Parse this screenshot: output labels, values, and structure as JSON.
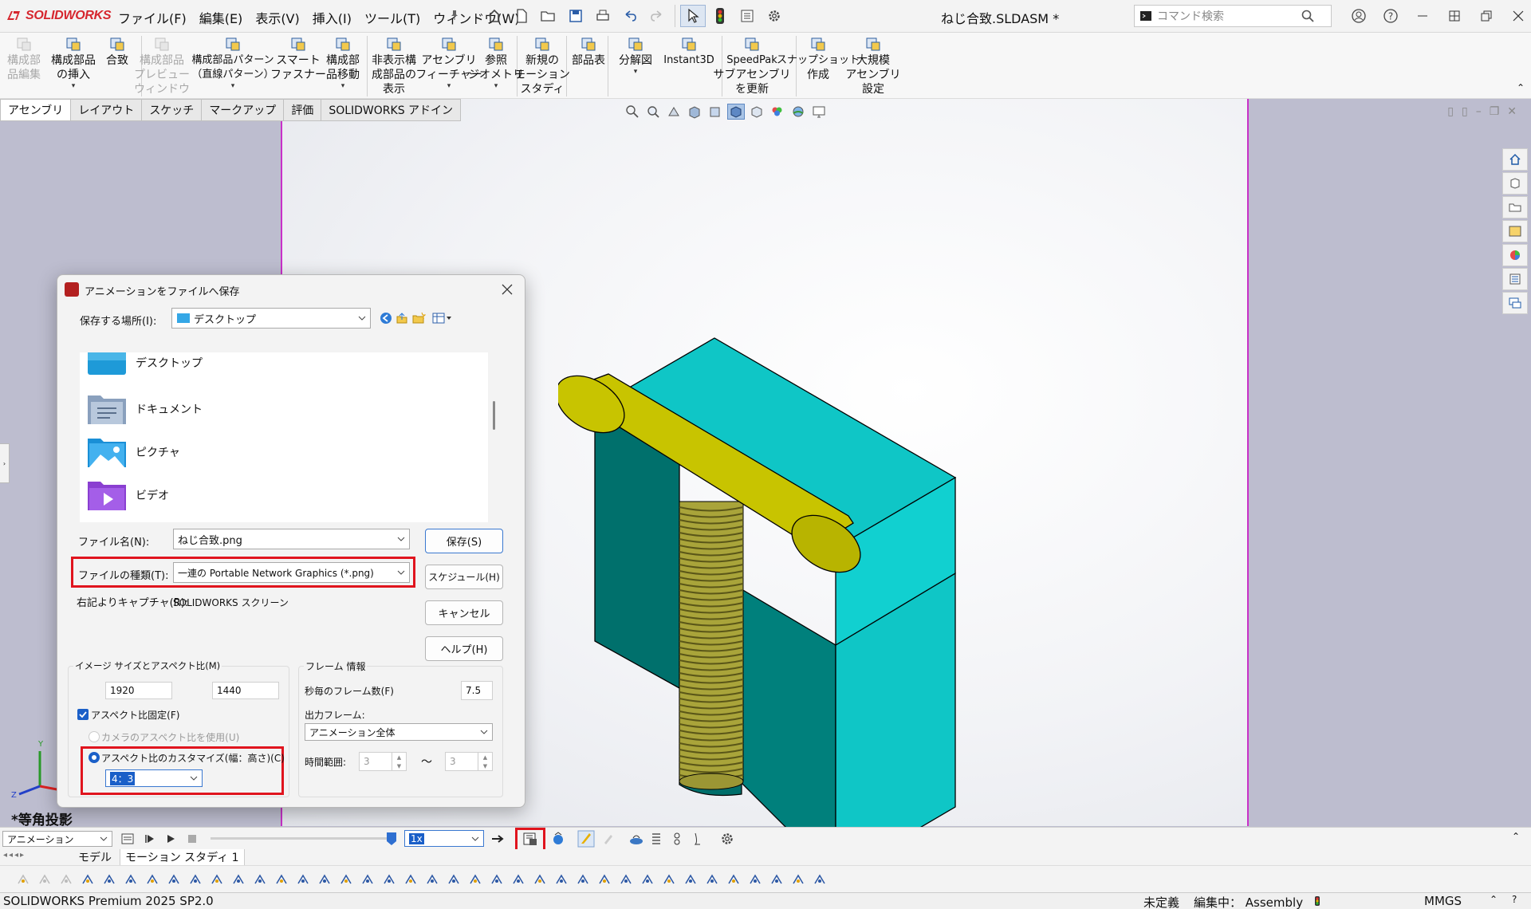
{
  "app": {
    "brand": "SOLIDWORKS",
    "doc_title": "ねじ合致.SLDASM *"
  },
  "menu": [
    "ファイル(F)",
    "編集(E)",
    "表示(V)",
    "挿入(I)",
    "ツール(T)",
    "ウィンドウ(W)"
  ],
  "search": {
    "placeholder": "コマンド検索"
  },
  "ribbon": [
    {
      "l1": "構成部",
      "l2": "品編集",
      "l3": "",
      "disabled": true,
      "icon": "edit-component-icon"
    },
    {
      "l1": "構成部品",
      "l2": "の挿入",
      "l3": "",
      "disabled": false,
      "icon": "insert-components-icon",
      "dropdown": true
    },
    {
      "l1": "合致",
      "l2": "",
      "l3": "",
      "disabled": false,
      "icon": "mate-icon"
    },
    {
      "l1": "構成部品",
      "l2": "プレビュー",
      "l3": "ウィンドウ",
      "disabled": true,
      "icon": "component-preview-icon"
    },
    {
      "l1": "構成部品パターン",
      "l2": "（直線パターン）",
      "l3": "",
      "disabled": false,
      "icon": "linear-pattern-icon",
      "dropdown": true
    },
    {
      "l1": "スマート",
      "l2": "ファスナー",
      "l3": "",
      "disabled": false,
      "icon": "smart-fasteners-icon"
    },
    {
      "l1": "構成部",
      "l2": "品移動",
      "l3": "",
      "disabled": false,
      "icon": "move-component-icon",
      "dropdown": true
    },
    {
      "l1": "非表示構",
      "l2": "成部品の",
      "l3": "表示",
      "disabled": false,
      "icon": "show-hidden-icon"
    },
    {
      "l1": "アセンブリ",
      "l2": "フィーチャー",
      "l3": "",
      "disabled": false,
      "icon": "assembly-features-icon",
      "dropdown": true
    },
    {
      "l1": "参照",
      "l2": "ジオメトリ",
      "l3": "",
      "disabled": false,
      "icon": "reference-geometry-icon",
      "dropdown": true
    },
    {
      "l1": "新規の",
      "l2": "モーション",
      "l3": "スタディ",
      "disabled": false,
      "icon": "new-motion-study-icon"
    },
    {
      "l1": "部品表",
      "l2": "",
      "l3": "",
      "disabled": false,
      "icon": "bom-icon"
    },
    {
      "l1": "分解図",
      "l2": "",
      "l3": "",
      "disabled": false,
      "icon": "exploded-view-icon",
      "dropdown": true
    },
    {
      "l1": "Instant3D",
      "l2": "",
      "l3": "",
      "disabled": false,
      "icon": "instant3d-icon"
    },
    {
      "l1": "SpeedPak",
      "l2": "サブアセンブリ",
      "l3": "を更新",
      "disabled": false,
      "icon": "speedpak-icon"
    },
    {
      "l1": "スナップショット",
      "l2": "作成",
      "l3": "",
      "disabled": false,
      "icon": "snapshot-icon"
    },
    {
      "l1": "大規模",
      "l2": "アセンブリ",
      "l3": "設定",
      "disabled": false,
      "icon": "large-assembly-icon"
    }
  ],
  "tabs": [
    "アセンブリ",
    "レイアウト",
    "スケッチ",
    "マークアップ",
    "評価",
    "SOLIDWORKS アドイン"
  ],
  "view": {
    "name": "*等角投影"
  },
  "dialog": {
    "title": "アニメーションをファイルへ保存",
    "save_in_label": "保存する場所(I):",
    "save_in_value": "デスクトップ",
    "files": [
      "デスクトップ",
      "ドキュメント",
      "ピクチャ",
      "ビデオ"
    ],
    "filename_label": "ファイル名(N):",
    "filename_value": "ねじ合致.png",
    "filetype_label": "ファイルの種類(T):",
    "filetype_value": "一連の Portable Network Graphics (*.png)",
    "capture_label": "右記よりキャプチャ(R):",
    "capture_value": "SOLIDWORKS スクリーン",
    "buttons": {
      "save": "保存(S)",
      "schedule": "スケジュール(H)",
      "cancel": "キャンセル",
      "help": "ヘルプ(H)"
    },
    "image_group": {
      "title": "イメージ サイズとアスペクト比(M)",
      "width": "1920",
      "height": "1440",
      "fix_aspect": "アスペクト比固定(F)",
      "fix_aspect_checked": true,
      "camera_aspect": "カメラのアスペクト比を使用(U)",
      "custom_aspect": "アスペクト比のカスタマイズ(幅：高さ)(C)",
      "custom_aspect_selected": true,
      "ratio": "4：3"
    },
    "frame_group": {
      "title": "フレーム 情報",
      "fps_label": "秒毎のフレーム数(F)",
      "fps_value": "7.5",
      "output_label": "出力フレーム:",
      "output_value": "アニメーション全体",
      "range_label": "時間範囲:",
      "range_from": "3",
      "range_sep": "〜",
      "range_to": "3"
    }
  },
  "animation_bar": {
    "mode": "アニメーション",
    "speed": "1x"
  },
  "motion_tabs": [
    "モデル",
    "モーション スタディ 1"
  ],
  "status": {
    "product": "SOLIDWORKS Premium 2025 SP2.0",
    "state": "未定義",
    "editing": "編集中： Assembly",
    "units": "MMGS"
  },
  "colors": {
    "highlight_red": "#e0141e",
    "viewport_bg": "#bdbdcf",
    "sheet_border": "#c830c8",
    "block_teal": "#0fc6c6",
    "pin_yellow": "#c8c400"
  }
}
